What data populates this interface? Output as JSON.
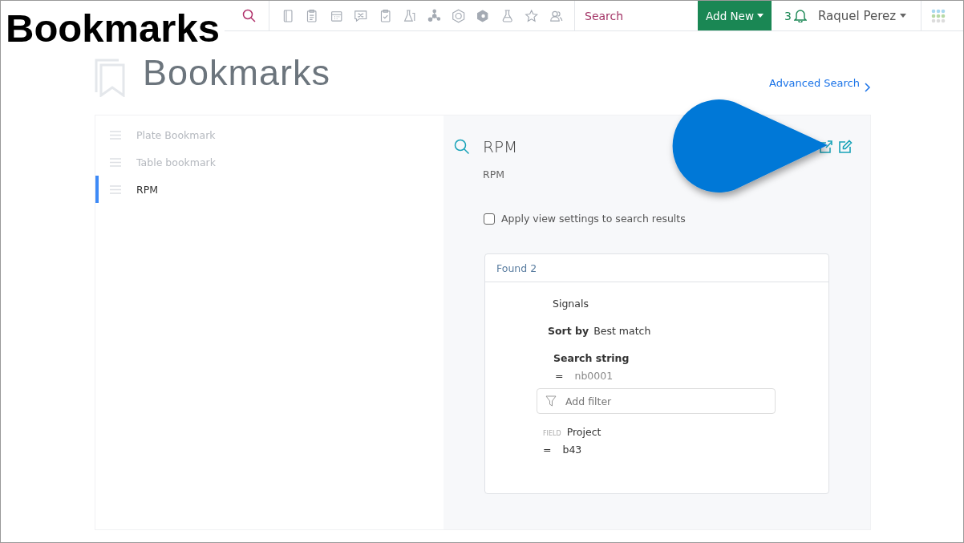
{
  "overlay_title": "Bookmarks",
  "topbar": {
    "search_placeholder": "Search",
    "add_new": "Add New",
    "notifications": "3",
    "user": "Raquel Perez"
  },
  "page": {
    "title": "Bookmarks",
    "advanced_search": "Advanced Search"
  },
  "bookmarks": [
    {
      "label": "Plate Bookmark",
      "selected": false
    },
    {
      "label": "Table bookmark",
      "selected": false
    },
    {
      "label": "RPM",
      "selected": true
    }
  ],
  "detail": {
    "title": "RPM",
    "description": "RPM",
    "apply_view_settings": {
      "label": "Apply view settings to search results",
      "checked": false
    },
    "results": {
      "header": "Found 2",
      "entity": "Signals",
      "sort_label": "Sort by",
      "sort_value": "Best match",
      "search_string_label": "Search string",
      "search_operator": "=",
      "search_value": "nb0001",
      "filter_placeholder": "Add filter",
      "field_tag": "FIELD",
      "field_name": "Project",
      "field_operator": "=",
      "field_value": "b43"
    }
  }
}
